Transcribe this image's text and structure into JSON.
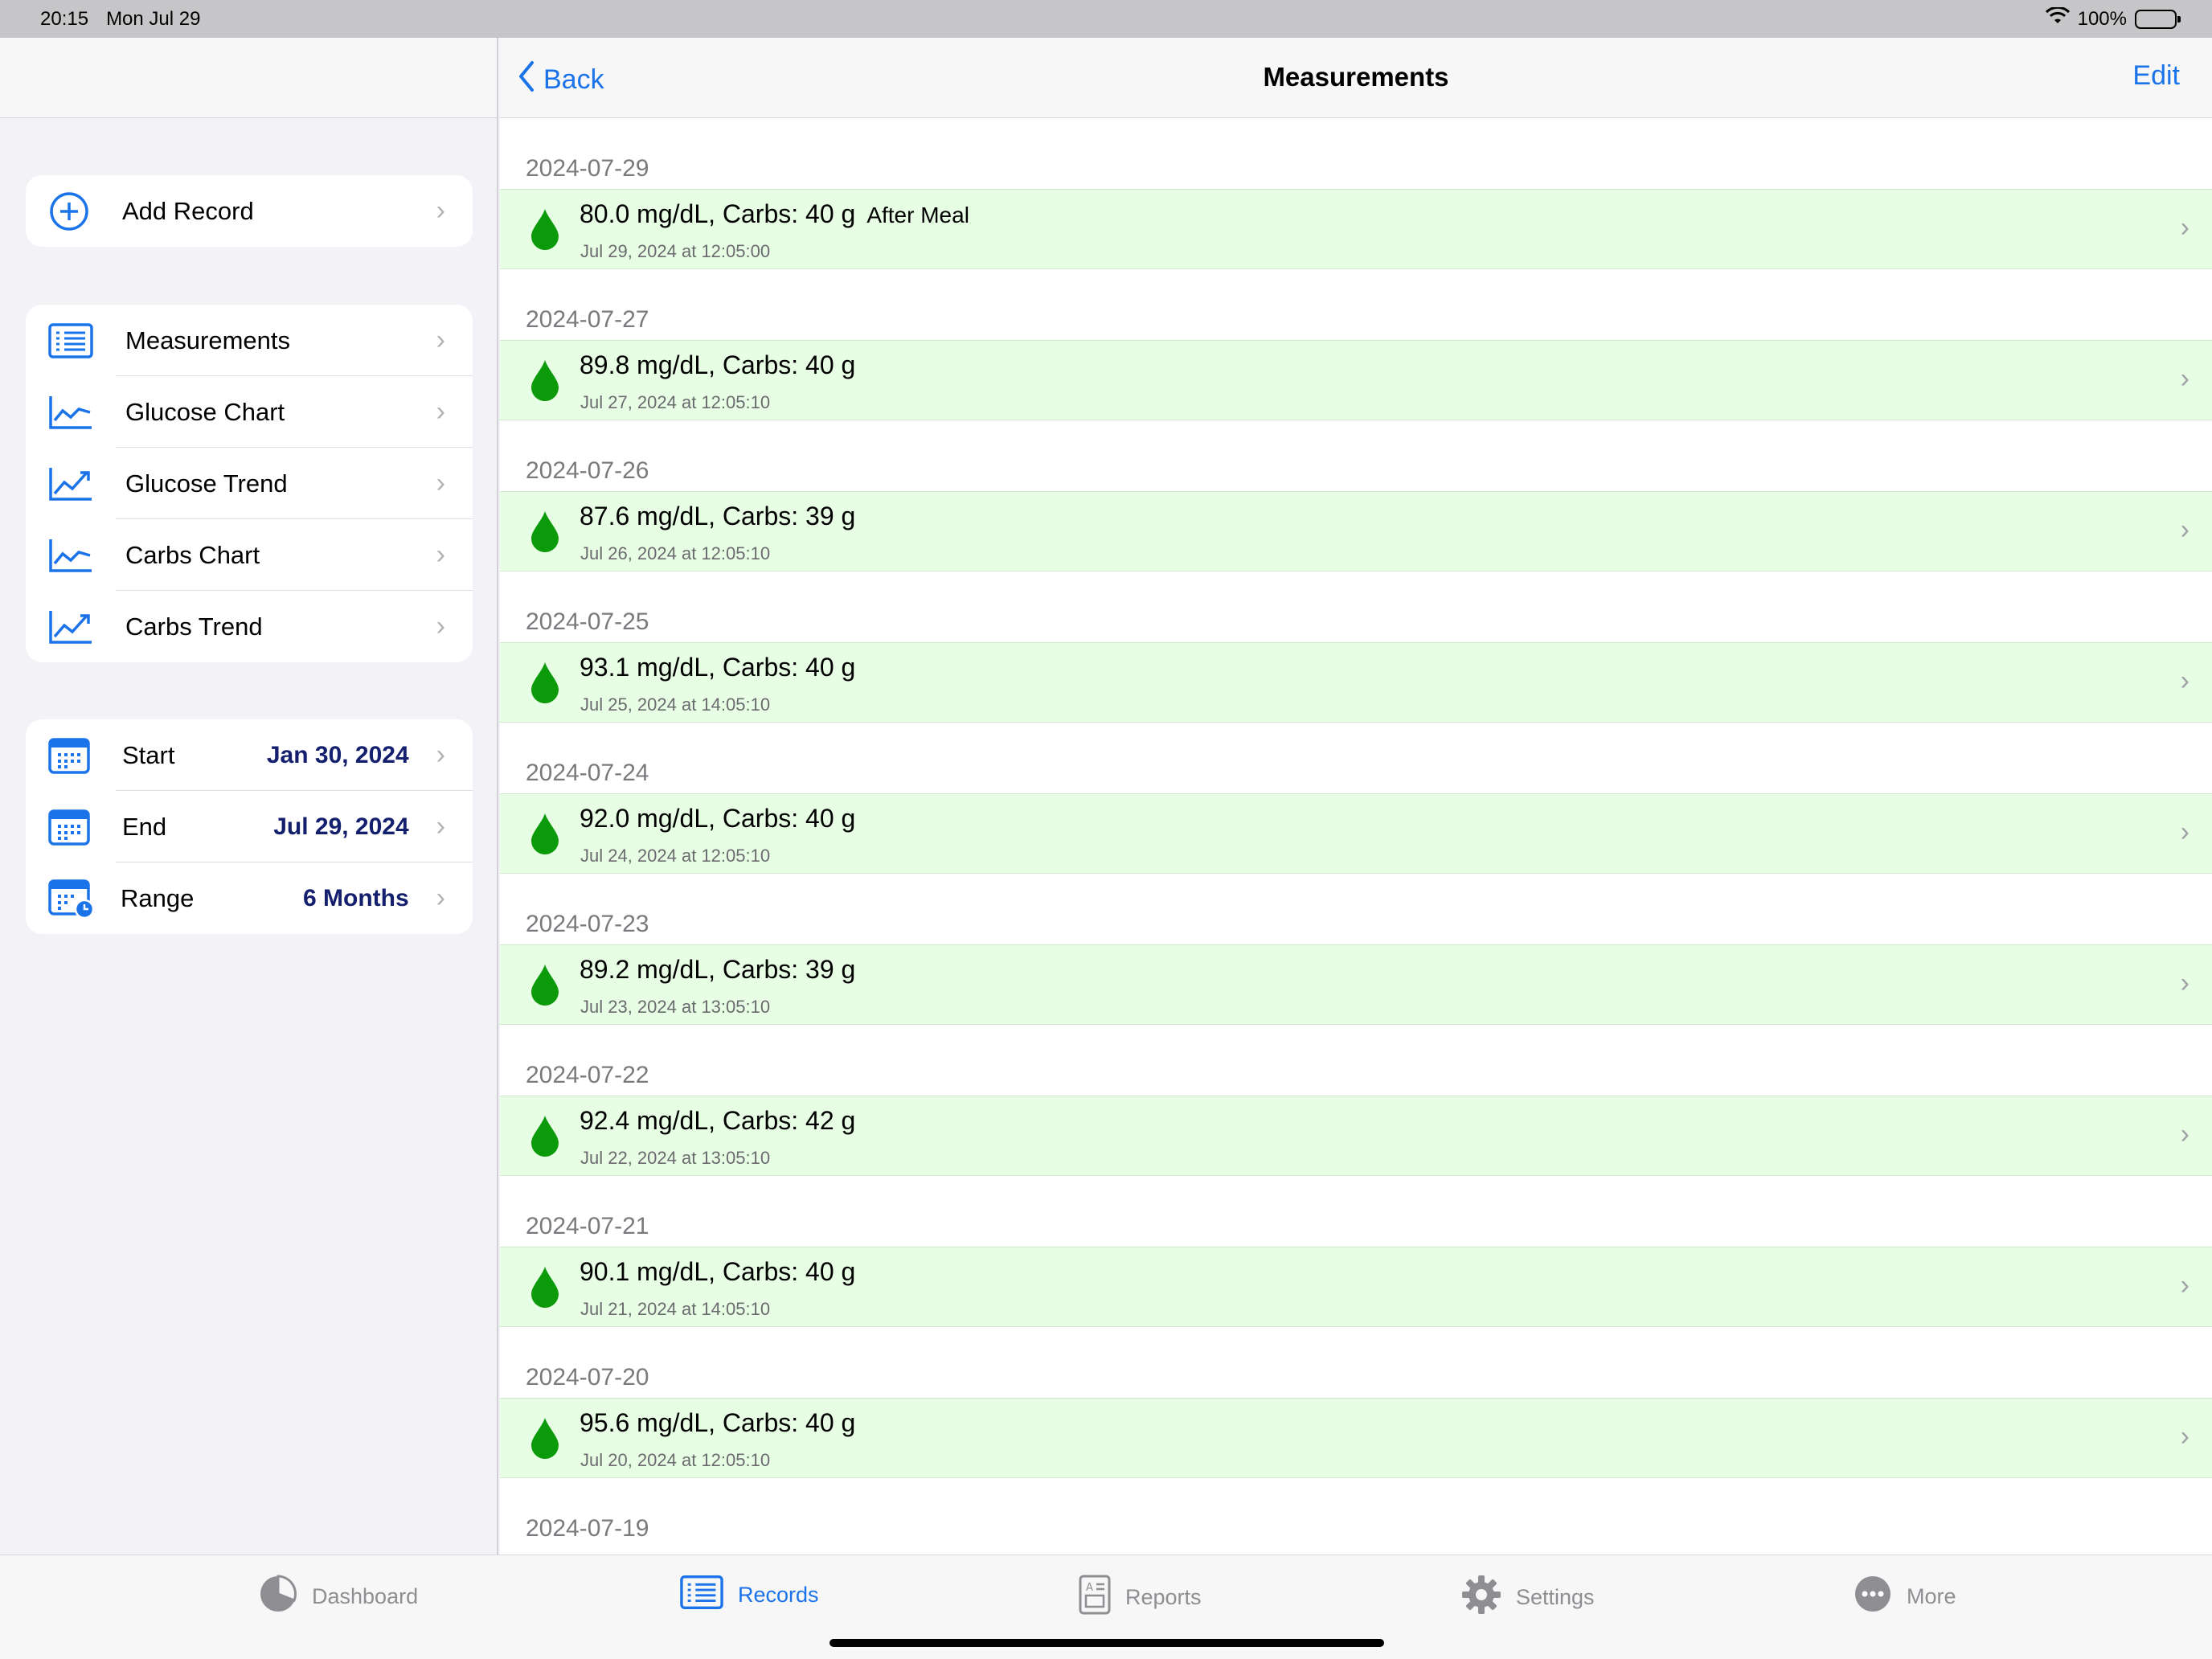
{
  "status": {
    "time": "20:15",
    "date": "Mon Jul 29",
    "battery": "100%"
  },
  "colors": {
    "accent": "#1a73e8",
    "record_bg": "#e7fde4",
    "drop": "#0a9a0a",
    "value_text": "#14206e"
  },
  "sidebar": {
    "add": {
      "label": "Add Record",
      "icon": "plus-circle-icon"
    },
    "nav": [
      {
        "label": "Measurements",
        "icon": "list-icon"
      },
      {
        "label": "Glucose Chart",
        "icon": "line-chart-icon"
      },
      {
        "label": "Glucose Trend",
        "icon": "trend-icon"
      },
      {
        "label": "Carbs Chart",
        "icon": "line-chart-icon"
      },
      {
        "label": "Carbs Trend",
        "icon": "trend-icon"
      }
    ],
    "range": [
      {
        "label": "Start",
        "value": "Jan 30, 2024",
        "icon": "calendar-icon"
      },
      {
        "label": "End",
        "value": "Jul 29, 2024",
        "icon": "calendar-icon"
      },
      {
        "label": "Range",
        "value": "6 Months",
        "icon": "calendar-clock-icon"
      }
    ]
  },
  "navbar": {
    "back": "Back",
    "title": "Measurements",
    "edit": "Edit"
  },
  "records": [
    {
      "date": "2024-07-29",
      "value": "80.0 mg/dL, Carbs: 40 g",
      "tag": "After Meal",
      "timestamp": "Jul 29, 2024 at 12:05:00"
    },
    {
      "date": "2024-07-27",
      "value": "89.8 mg/dL, Carbs: 40 g",
      "tag": "",
      "timestamp": "Jul 27, 2024 at 12:05:10"
    },
    {
      "date": "2024-07-26",
      "value": "87.6 mg/dL, Carbs: 39 g",
      "tag": "",
      "timestamp": "Jul 26, 2024 at 12:05:10"
    },
    {
      "date": "2024-07-25",
      "value": "93.1 mg/dL, Carbs: 40 g",
      "tag": "",
      "timestamp": "Jul 25, 2024 at 14:05:10"
    },
    {
      "date": "2024-07-24",
      "value": "92.0 mg/dL, Carbs: 40 g",
      "tag": "",
      "timestamp": "Jul 24, 2024 at 12:05:10"
    },
    {
      "date": "2024-07-23",
      "value": "89.2 mg/dL, Carbs: 39 g",
      "tag": "",
      "timestamp": "Jul 23, 2024 at 13:05:10"
    },
    {
      "date": "2024-07-22",
      "value": "92.4 mg/dL, Carbs: 42 g",
      "tag": "",
      "timestamp": "Jul 22, 2024 at 13:05:10"
    },
    {
      "date": "2024-07-21",
      "value": "90.1 mg/dL, Carbs: 40 g",
      "tag": "",
      "timestamp": "Jul 21, 2024 at 14:05:10"
    },
    {
      "date": "2024-07-20",
      "value": "95.6 mg/dL, Carbs: 40 g",
      "tag": "",
      "timestamp": "Jul 20, 2024 at 12:05:10"
    }
  ],
  "trailing_section": "2024-07-19",
  "tabs": [
    {
      "label": "Dashboard",
      "icon": "pie-chart-icon",
      "active": false
    },
    {
      "label": "Records",
      "icon": "list-icon",
      "active": true
    },
    {
      "label": "Reports",
      "icon": "report-icon",
      "active": false
    },
    {
      "label": "Settings",
      "icon": "gear-icon",
      "active": false
    },
    {
      "label": "More",
      "icon": "ellipsis-icon",
      "active": false
    }
  ]
}
